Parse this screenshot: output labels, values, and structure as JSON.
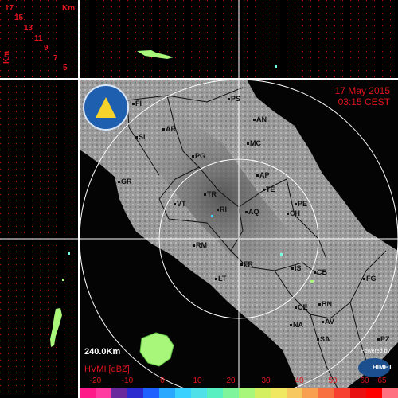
{
  "timestamp": {
    "date": "17 May 2015",
    "time": "03:15 CEST"
  },
  "range_label": "240.0Km",
  "unit_label": "HVMI [dBZ]",
  "powered_by": "Powered by",
  "brand": "HIMET",
  "km_label": "Km",
  "km_label_vertical": "Km",
  "height_scale": [
    "17",
    "15",
    "13",
    "11",
    "9",
    "7",
    "5"
  ],
  "colorbar_ticks": [
    "-20",
    "-10",
    "0",
    "10",
    "20",
    "30",
    "40",
    "50",
    "60",
    "65"
  ],
  "colorbar_colors": [
    "#ff1a8a",
    "#ff3aa0",
    "#6a2a9e",
    "#2b2bd0",
    "#1e60ff",
    "#2aa8ff",
    "#3ad0ff",
    "#4fe0e8",
    "#58f0c0",
    "#7ef59a",
    "#a8f77a",
    "#d4f060",
    "#f0e860",
    "#f8c860",
    "#f8a050",
    "#f87040",
    "#f84030",
    "#e81010",
    "#ff0000",
    "#ff7080"
  ],
  "cities": [
    "PS",
    "FI",
    "AN",
    "AR",
    "SI",
    "MC",
    "PG",
    "GR",
    "AP",
    "TE",
    "TR",
    "PE",
    "VT",
    "RI",
    "AQ",
    "CH",
    "RM",
    "FR",
    "IS",
    "CB",
    "FG",
    "LT",
    "CE",
    "BN",
    "NA",
    "AV",
    "SA",
    "PZ"
  ],
  "logo_name": "Protezione Civile"
}
